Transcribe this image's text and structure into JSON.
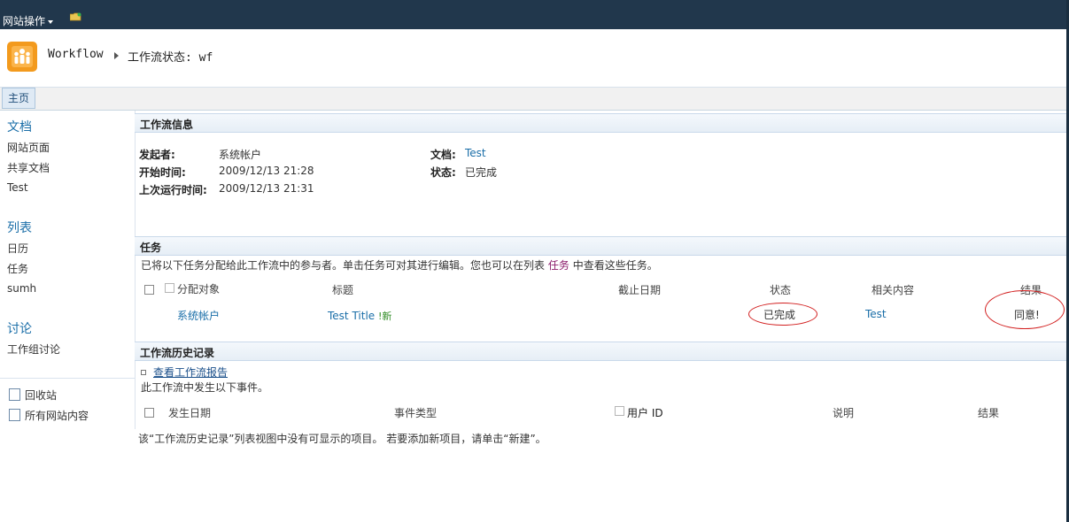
{
  "topbar": {
    "site_actions": "网站操作"
  },
  "breadcrumb": {
    "root": "Workflow",
    "page": "工作流状态: wf"
  },
  "topnav": {
    "home_tab": "主页"
  },
  "leftnav": {
    "documents_heading": "文档",
    "documents": [
      "网站页面",
      "共享文档",
      "Test"
    ],
    "lists_heading": "列表",
    "lists": [
      "日历",
      "任务",
      "sumh"
    ],
    "discussions_heading": "讨论",
    "discussions": [
      "工作组讨论"
    ],
    "recycle_bin": "回收站",
    "all_content": "所有网站内容"
  },
  "workflow_info": {
    "title": "工作流信息",
    "initiator_label": "发起者:",
    "initiator_value": "系统帐户",
    "started_label": "开始时间:",
    "started_value": "2009/12/13 21:28",
    "last_run_label": "上次运行时间:",
    "last_run_value": "2009/12/13 21:31",
    "document_label": "文档:",
    "document_value": "Test",
    "status_label": "状态:",
    "status_value": "已完成"
  },
  "tasks": {
    "title": "任务",
    "description_before": "已将以下任务分配给此工作流中的参与者。单击任务可对其进行编辑。您也可以在列表",
    "description_link": "任务",
    "description_after": "中查看这些任务。",
    "columns": {
      "assigned_to": "分配对象",
      "title": "标题",
      "due_date": "截止日期",
      "status": "状态",
      "related": "相关内容",
      "outcome": "结果"
    },
    "rows": [
      {
        "assigned_to": "系统帐户",
        "title": "Test Title",
        "new_mark": "!新",
        "due_date": "",
        "status": "已完成",
        "related": "Test",
        "outcome": "同意!"
      }
    ]
  },
  "history": {
    "title": "工作流历史记录",
    "report_link": "查看工作流报告",
    "note": "此工作流中发生以下事件。",
    "columns": {
      "date": "发生日期",
      "event_type": "事件类型",
      "user_id": "用户 ID",
      "description": "说明",
      "outcome": "结果"
    },
    "empty_message": "该“工作流历史记录”列表视图中没有可显示的项目。 若要添加新项目，请单击“新建”。"
  },
  "colors": {
    "topbar": "#21374c",
    "link": "#1a6ea8",
    "accent_orange": "#f39a1d",
    "annotation_red": "#d21f1f"
  },
  "icons": [
    "folder-icon",
    "site-logo-icon",
    "recycle-bin-icon",
    "all-content-icon"
  ]
}
